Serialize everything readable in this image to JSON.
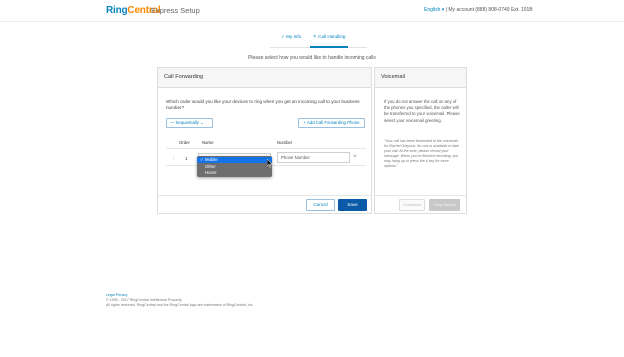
{
  "header": {
    "logo_ring": "Ring",
    "logo_central": "Central",
    "app_subtitle": "Express Setup",
    "language": "English ▾",
    "account": "| My account",
    "phone": "(888) 808-0749  Ext. 101B"
  },
  "steps": [
    {
      "label": "✓ My Info",
      "active": false
    },
    {
      "label": "✎ Call Handling",
      "active": true
    }
  ],
  "instruction": "Please select how you would like to handle incoming calls",
  "call_forwarding": {
    "title": "Call Forwarding",
    "question": "Which order would you like your devices to ring when you get an incoming call to your business number?",
    "mode_dropdown": "— Sequentially ⌄",
    "add_button": "+ Add Call Forwarding Phone",
    "columns": {
      "order": "Order",
      "name": "Name",
      "number": "Number"
    },
    "row": {
      "order": "1",
      "number_placeholder": "Phone Number"
    },
    "name_options": [
      "Mobile",
      "Other",
      "Home"
    ],
    "selected_option": "Mobile",
    "cancel": "Cancel",
    "save": "Save"
  },
  "voicemail": {
    "title": "Voicemail",
    "text": "If you do not answer the call on any of the phones you specified, the caller will be transferred to your voicemail. Please select your voicemail greeting.",
    "quote": "\"Your call has been forwarded to the voicemail for Rachel Grayson. No one is available to take your call. At the tone, please record your message. When you've finished recording, you may hang up or press the # key for more options.\"",
    "customize": "Customize",
    "keep_default": "Keep Default"
  },
  "footer": {
    "links": "Legal  Privacy",
    "line1": "© 1999 - 2017 RingCentral Intellectual Property.",
    "line2": "All rights reserved. RingCentral and the RingCentral logo are trademarks of RingCentral, Inc."
  },
  "colors": {
    "brand_blue": "#0684bd",
    "brand_orange": "#ff8800",
    "save_button": "#0a5aa8",
    "menu_highlight": "#1473e6"
  }
}
